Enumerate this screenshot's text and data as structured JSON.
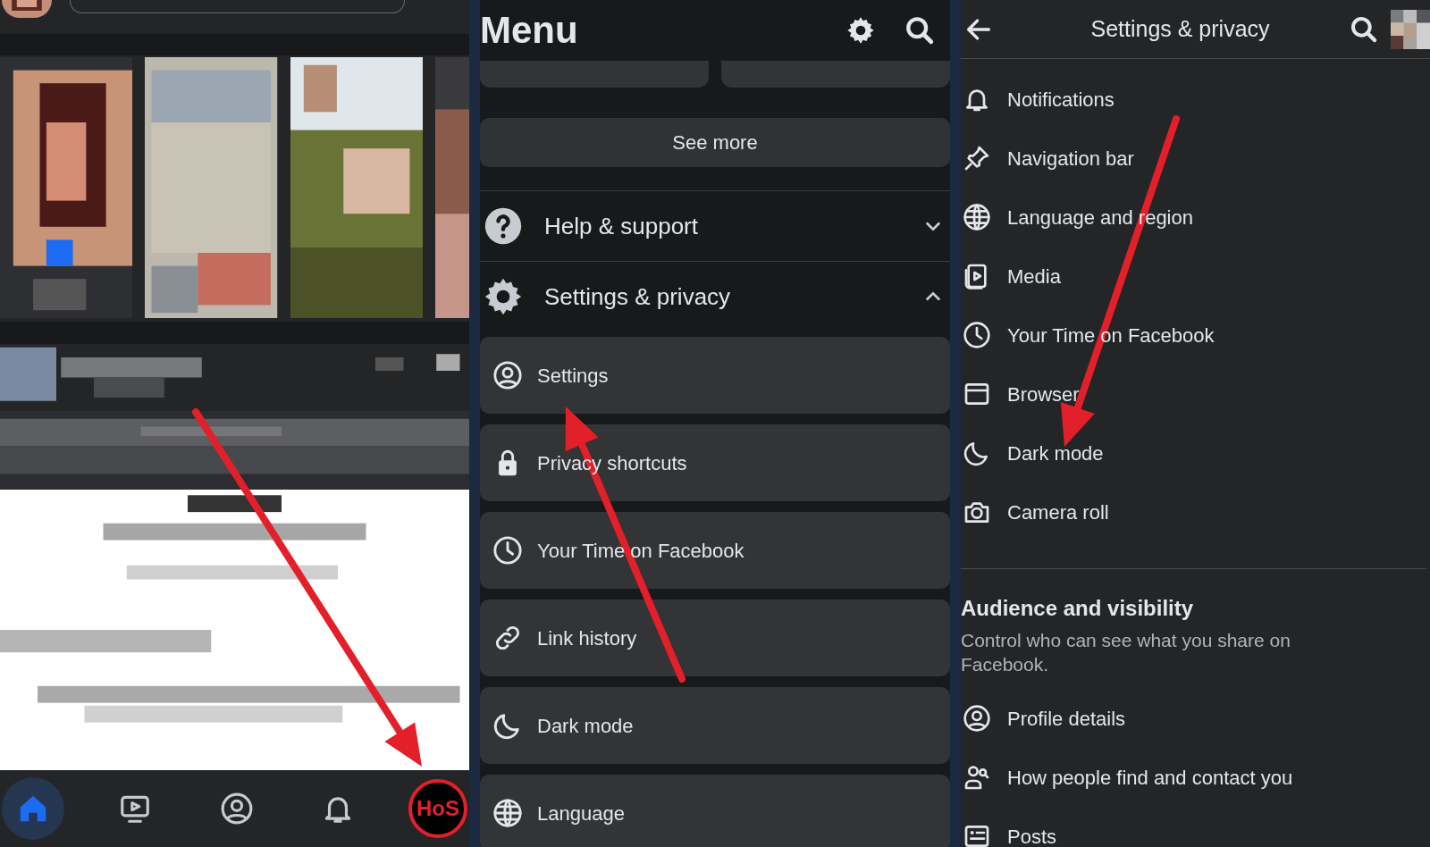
{
  "feed_panel": {
    "annotated": true,
    "bottom_nav": [
      {
        "kind": "home",
        "selected": true
      },
      {
        "kind": "video",
        "selected": false
      },
      {
        "kind": "profile",
        "selected": false
      },
      {
        "kind": "notifications",
        "selected": false
      },
      {
        "kind": "avatar",
        "text": "HoS",
        "selected": false,
        "highlighted": true
      }
    ]
  },
  "menu_panel": {
    "title": "Menu",
    "annotated": true,
    "see_more": "See more",
    "sections": [
      {
        "kind": "help",
        "label": "Help & support",
        "expanded": false
      },
      {
        "kind": "settings",
        "label": "Settings & privacy",
        "expanded": true,
        "items": [
          {
            "kind": "profile",
            "label": "Settings"
          },
          {
            "kind": "lock",
            "label": "Privacy shortcuts"
          },
          {
            "kind": "clock",
            "label": "Your Time on Facebook"
          },
          {
            "kind": "link",
            "label": "Link history"
          },
          {
            "kind": "moon",
            "label": "Dark mode"
          },
          {
            "kind": "globe",
            "label": "Language"
          }
        ]
      }
    ]
  },
  "settings_panel": {
    "title": "Settings & privacy",
    "annotated": true,
    "items": [
      {
        "kind": "bell",
        "label": "Notifications"
      },
      {
        "kind": "pin",
        "label": "Navigation bar"
      },
      {
        "kind": "globe",
        "label": "Language and region"
      },
      {
        "kind": "media",
        "label": "Media"
      },
      {
        "kind": "clock",
        "label": "Your Time on Facebook"
      },
      {
        "kind": "browser",
        "label": "Browser"
      },
      {
        "kind": "moon",
        "label": "Dark mode"
      },
      {
        "kind": "camera",
        "label": "Camera roll"
      }
    ],
    "section": {
      "heading": "Audience and visibility",
      "description": "Control who can see what you share on Facebook.",
      "items": [
        {
          "kind": "profile",
          "label": "Profile details"
        },
        {
          "kind": "people",
          "label": "How people find and contact you"
        },
        {
          "kind": "posts",
          "label": "Posts"
        }
      ]
    }
  }
}
